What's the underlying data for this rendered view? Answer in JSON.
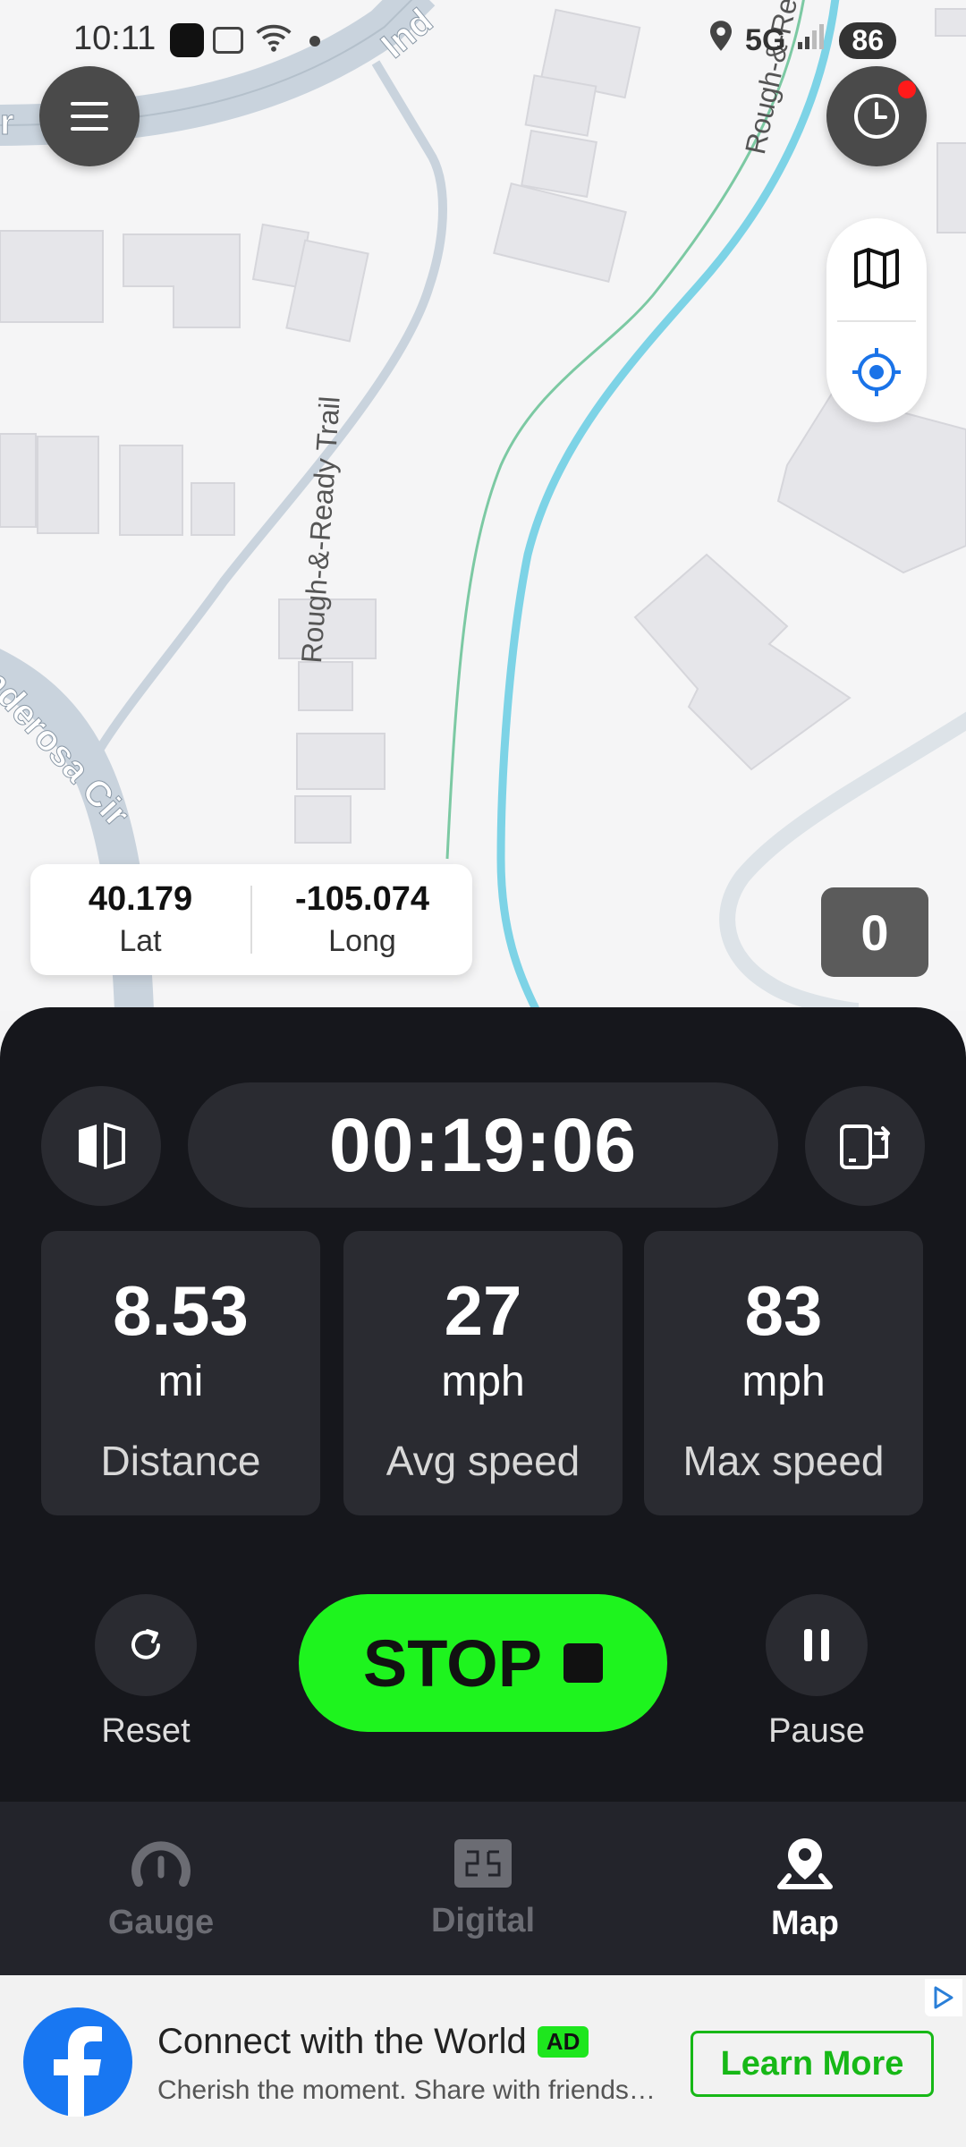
{
  "status_bar": {
    "time": "10:11",
    "network": "5G",
    "battery": "86"
  },
  "map": {
    "street_labels": [
      "Rough-&-Ready Trail",
      "Rough-&-Re",
      "Ponderosa Cir",
      "Ind",
      "r"
    ]
  },
  "coords": {
    "lat_value": "40.179",
    "lat_label": "Lat",
    "long_value": "-105.074",
    "long_label": "Long"
  },
  "speed_display": "0",
  "timer": "00:19:06",
  "stats": [
    {
      "value": "8.53",
      "unit": "mi",
      "label": "Distance"
    },
    {
      "value": "27",
      "unit": "mph",
      "label": "Avg speed"
    },
    {
      "value": "83",
      "unit": "mph",
      "label": "Max speed"
    }
  ],
  "controls": {
    "reset_label": "Reset",
    "stop_label": "STOP",
    "pause_label": "Pause"
  },
  "nav": [
    {
      "label": "Gauge",
      "icon": "gauge-icon",
      "active": false
    },
    {
      "label": "Digital",
      "icon": "digital-icon",
      "active": false
    },
    {
      "label": "Map",
      "icon": "map-pin-icon",
      "active": true
    }
  ],
  "ad": {
    "title": "Connect with the World",
    "badge": "AD",
    "subtitle": "Cherish the moment. Share with friends ...",
    "cta": "Learn More"
  },
  "colors": {
    "accent": "#1ef41e",
    "panel": "#16171c",
    "card": "#2a2b31",
    "locate_blue": "#1a73e8",
    "river": "#7dd3e6"
  }
}
